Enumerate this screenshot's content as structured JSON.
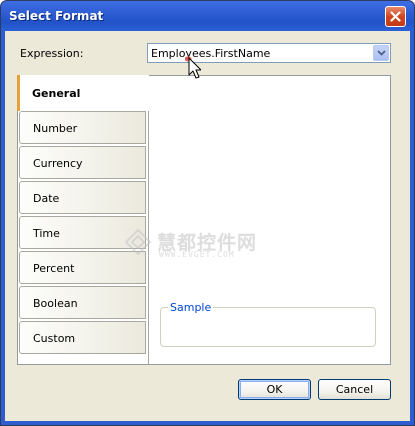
{
  "window": {
    "title": "Select Format"
  },
  "expression": {
    "label": "Expression:",
    "value": "Employees.FirstName"
  },
  "tabs": [
    {
      "label": "General",
      "selected": true
    },
    {
      "label": "Number",
      "selected": false
    },
    {
      "label": "Currency",
      "selected": false
    },
    {
      "label": "Date",
      "selected": false
    },
    {
      "label": "Time",
      "selected": false
    },
    {
      "label": "Percent",
      "selected": false
    },
    {
      "label": "Boolean",
      "selected": false
    },
    {
      "label": "Custom",
      "selected": false
    }
  ],
  "sample": {
    "label": "Sample",
    "value": ""
  },
  "buttons": {
    "ok": "OK",
    "cancel": "Cancel"
  },
  "watermark": {
    "text": "慧都控件网",
    "url": "WWW.EVGET.COM"
  },
  "colors": {
    "titlebar": "#2b5dd3",
    "dialog_bg": "#ece9d8",
    "selected_tab_accent": "#e6a23a",
    "sample_label": "#0046d5",
    "close_button": "#d0461f"
  },
  "icons": {
    "close": "close-icon",
    "dropdown": "chevron-down-icon",
    "cursor": "mouse-pointer-icon",
    "watermark": "logo-icon"
  }
}
